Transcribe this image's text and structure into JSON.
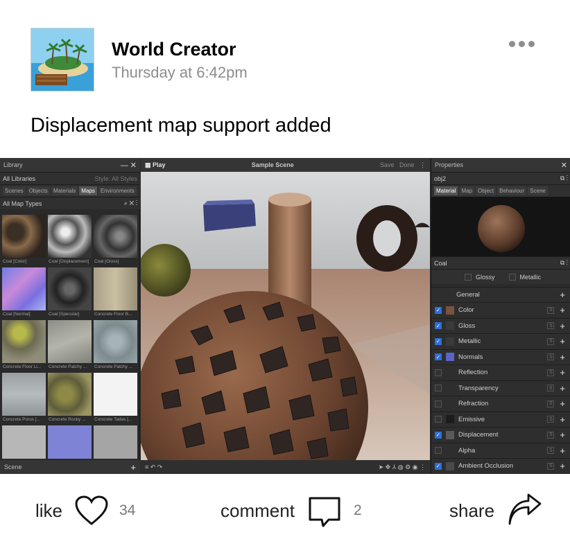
{
  "post": {
    "author": "World Creator",
    "timestamp": "Thursday at 6:42pm",
    "text": "Displacement map support added"
  },
  "app": {
    "library": {
      "title": "Library",
      "libraries": "All Libraries",
      "style": "Style: All Styles",
      "tabs": [
        "Scenes",
        "Objects",
        "Materials",
        "Maps",
        "Environments"
      ],
      "active_tab": "Maps",
      "map_types": "All Map Types",
      "thumbs": [
        {
          "label": "Coal [Color]"
        },
        {
          "label": "Coal [Displacement]"
        },
        {
          "label": "Coal [Gloss]"
        },
        {
          "label": "Coal [Normal]"
        },
        {
          "label": "Coal [Specular]"
        },
        {
          "label": "Concrete Floor B..."
        },
        {
          "label": "Concrete Floor Li..."
        },
        {
          "label": "Concrete Patchy ..."
        },
        {
          "label": "Concrete Patchy ..."
        },
        {
          "label": "Concrete Porus [..."
        },
        {
          "label": "Concrete Rocky ..."
        },
        {
          "label": "Concrete Tadas [..."
        },
        {
          "label": ""
        },
        {
          "label": ""
        },
        {
          "label": ""
        }
      ],
      "scene": "Scene"
    },
    "viewport": {
      "play": "Play",
      "scene_name": "Sample Scene",
      "save": "Save",
      "done": "Done"
    },
    "properties": {
      "title": "Properties",
      "object": "obj2",
      "tabs": [
        "Material",
        "Map",
        "Object",
        "Behaviour",
        "Scene"
      ],
      "active_tab": "Material",
      "material_name": "Coal",
      "glossy": "Glossy",
      "metallic": "Metallic",
      "general": "General",
      "channels": [
        {
          "label": "Color",
          "on": true
        },
        {
          "label": "Gloss",
          "on": true
        },
        {
          "label": "Metallic",
          "on": true
        },
        {
          "label": "Normals",
          "on": true
        },
        {
          "label": "Reflection",
          "on": false
        },
        {
          "label": "Transparency",
          "on": false
        },
        {
          "label": "Refraction",
          "on": false
        },
        {
          "label": "Emissive",
          "on": false
        },
        {
          "label": "Displacement",
          "on": true
        },
        {
          "label": "Alpha",
          "on": false
        },
        {
          "label": "Ambient Occlusion",
          "on": true
        }
      ]
    }
  },
  "actions": {
    "like_label": "like",
    "like_count": "34",
    "comment_label": "comment",
    "comment_count": "2",
    "share_label": "share"
  },
  "colors": {
    "timestamp": "#8d8d8d",
    "checkbox_on": "#2f6fd6"
  }
}
